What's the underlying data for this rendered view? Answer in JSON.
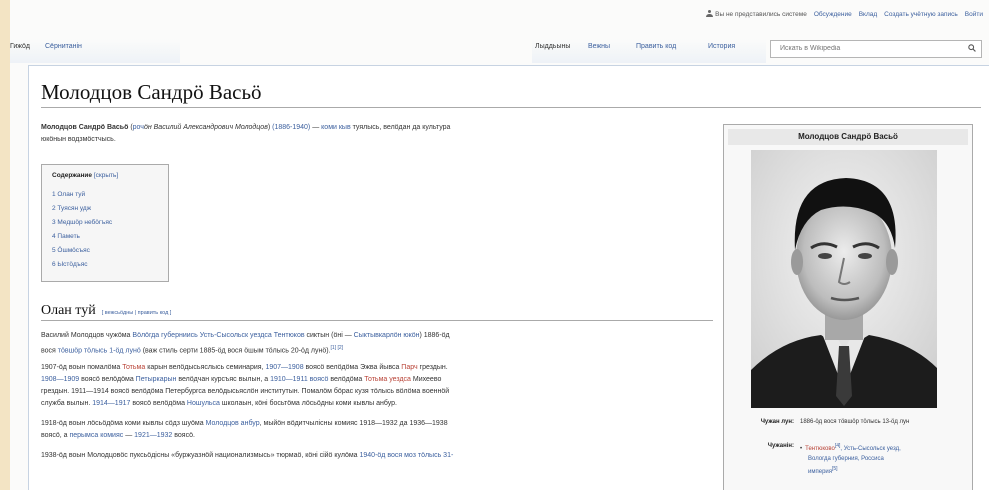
{
  "personal": {
    "user": "Вы не представились системе",
    "links": [
      "Обсуждение",
      "Вклад",
      "Создать учётную запись",
      "Войти"
    ]
  },
  "tabs": {
    "namespace": [
      "Гижӧд",
      "Сёрнитанін"
    ],
    "views": [
      "Лыддьыны",
      "Вежны",
      "Править код",
      "История"
    ]
  },
  "search": {
    "placeholder": "Искать в Wikipedia"
  },
  "article": {
    "title": "Молодцов Сандрӧ Васьӧ",
    "lead": {
      "name": "Молодцов Сандрӧ Васьӧ",
      "p1": " (",
      "rus_link": "роч",
      "p2": "ӧн Василий Александрович Молодцов",
      "p3": ") ",
      "years": "(1886-1940)",
      "p4": " — ",
      "komi": "коми кыв",
      "p5": " туялысь, велӧдан да культура",
      "line2": "юкӧнын водзмӧстчысь."
    },
    "toc": {
      "title": "Содержание",
      "toggle": "[скрыть]",
      "items": [
        "1  Олан туй",
        "2  Туясян удж",
        "3  Медшӧр небӧгъяс",
        "4  Паметь",
        "5  Ӧшмӧсъяс",
        "6  Ыстӧдъяс"
      ]
    },
    "section": {
      "title": "Олан туй",
      "edit": "[ вежсьӧдны | править код ]"
    },
    "paragraphs": {
      "a1": "Василий Молодцов чужӧма ",
      "a_l1": "Вӧлӧгда губерниись",
      "a2": " ",
      "a_l2": "Усть-Сысольск уездса",
      "a3": " ",
      "a_l3": "Тентюков",
      "a4": " сиктын (ӧні — ",
      "a_l4": "Сыктывкарлӧн юкӧн",
      "a5": ") 1886-ӧд",
      "a6": "вося ",
      "a_l5": "тӧвшӧр тӧлысь 1-ӧд лунӧ",
      "a7": " (важ стиль серти 1885-ӧд вося ӧшым тӧлысь 20-ӧд лунӧ).",
      "a_ref": "[1] [2]",
      "b1": "1907-ӧд воын помалӧма ",
      "b_l1": "Тотьма",
      "b2": " карын велӧдысьяслысь семинария, ",
      "b_l2": "1907—1908",
      "b3": " воясӧ велӧдӧма Эжва йывса ",
      "b_l3": "Парч",
      "b4": " грездын.",
      "c1": "1908—1909",
      "c2": " воясӧ велӧдӧма ",
      "c_l1": "Петыркарын",
      "c3": " велӧдчан курсъяс вылын, а ",
      "c_l2": "1910—1911",
      "c4": " ",
      "c_l3": "воясӧ",
      "c5": " велӧдӧма ",
      "c_l4": "Тотьма уездса",
      "c6": " Михеево",
      "d1": "грездын. 1911—1914 воясӧ велӧдӧма Петербургса велӧдысьяслӧн институтын. Помалӧм бӧрас кузя тӧлысь вӧлӧма военнӧй",
      "e1": "служба вылын. ",
      "e_l1": "1914—1917",
      "e2": " воясӧ велӧдӧма ",
      "e_l2": "Ношульса",
      "e3": " школаын, кӧні босьтӧма лӧсьӧдны коми кывлы анбур.",
      "f1": "1918-ӧд воын лӧсьӧдӧма коми кывлы сӧдз шуӧма ",
      "f_l1": "Молодцов анбур",
      "f2": ", мыйӧн вӧдитчылісны комияс 1918—1932 да 1936—1938",
      "f3": "воясӧ, а ",
      "f_l2": "перымса комияс",
      "f3b": " — ",
      "f_l3": "1921—1932",
      "f4": " воясӧ.",
      "g1": "1938-ӧд воын Молодцовӧс пуксьӧдісны «буржуазнӧй национализмысь» тюрмаӧ, кӧні сійӧ кулӧма ",
      "g_l1": "1940-ӧд вося моз тӧлысь 31-"
    }
  },
  "infobox": {
    "title": "Молодцов Сандрӧ Васьӧ",
    "born_label": "Чужан лун:",
    "born_value": "1886-ӧд вося тӧвшӧр тӧлысь 13-ӧд лун",
    "place_label": "Чужанін:",
    "place_link": "Тентюково",
    "place_ref": "[4]",
    "place_rest": ", Усть-Сысольск уезд,",
    "place_line2": "Вологда губерния, Россиса",
    "place_line3": "империя",
    "place_ref2": "[5]"
  },
  "colors": {
    "link": "#3b5f9e",
    "redlink": "#b84236",
    "background": "#f3e4c4"
  }
}
